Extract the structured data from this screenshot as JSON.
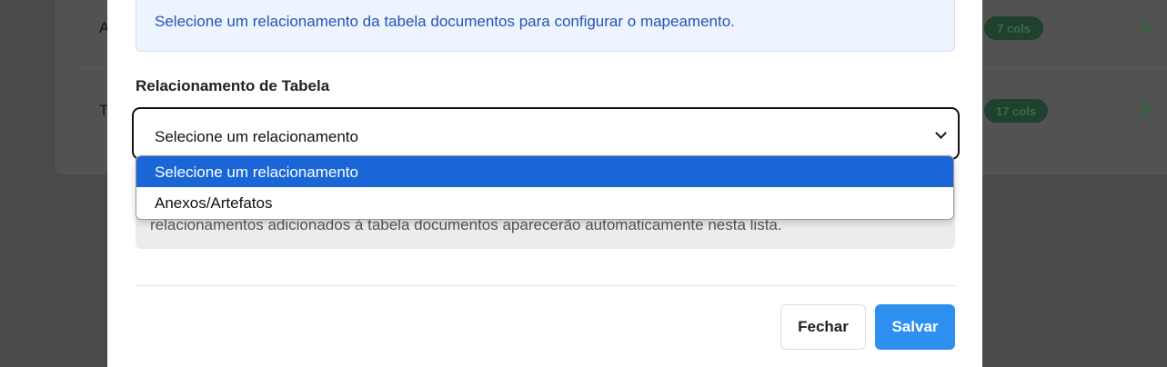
{
  "background": {
    "rows": [
      {
        "letter": "A",
        "badge": "7 cols"
      },
      {
        "letter": "T",
        "badge": "17 cols"
      }
    ]
  },
  "modal": {
    "info_text": "Selecione um relacionamento da tabela documentos para configurar o mapeamento.",
    "field_label": "Relacionamento de Tabela",
    "select_value": "Selecione um relacionamento",
    "options": [
      "Selecione um relacionamento",
      "Anexos/Artefatos"
    ],
    "selected_option": "Selecione um relacionamento",
    "note_text": "relacionamentos adicionados à tabela documentos aparecerão automaticamente nesta lista.",
    "buttons": {
      "close": "Fechar",
      "save": "Salvar"
    }
  },
  "colors": {
    "accent": "#2d8ff0",
    "highlight": "#1a66d6",
    "info_bg": "#eef4fe",
    "badge": "#21412f"
  }
}
